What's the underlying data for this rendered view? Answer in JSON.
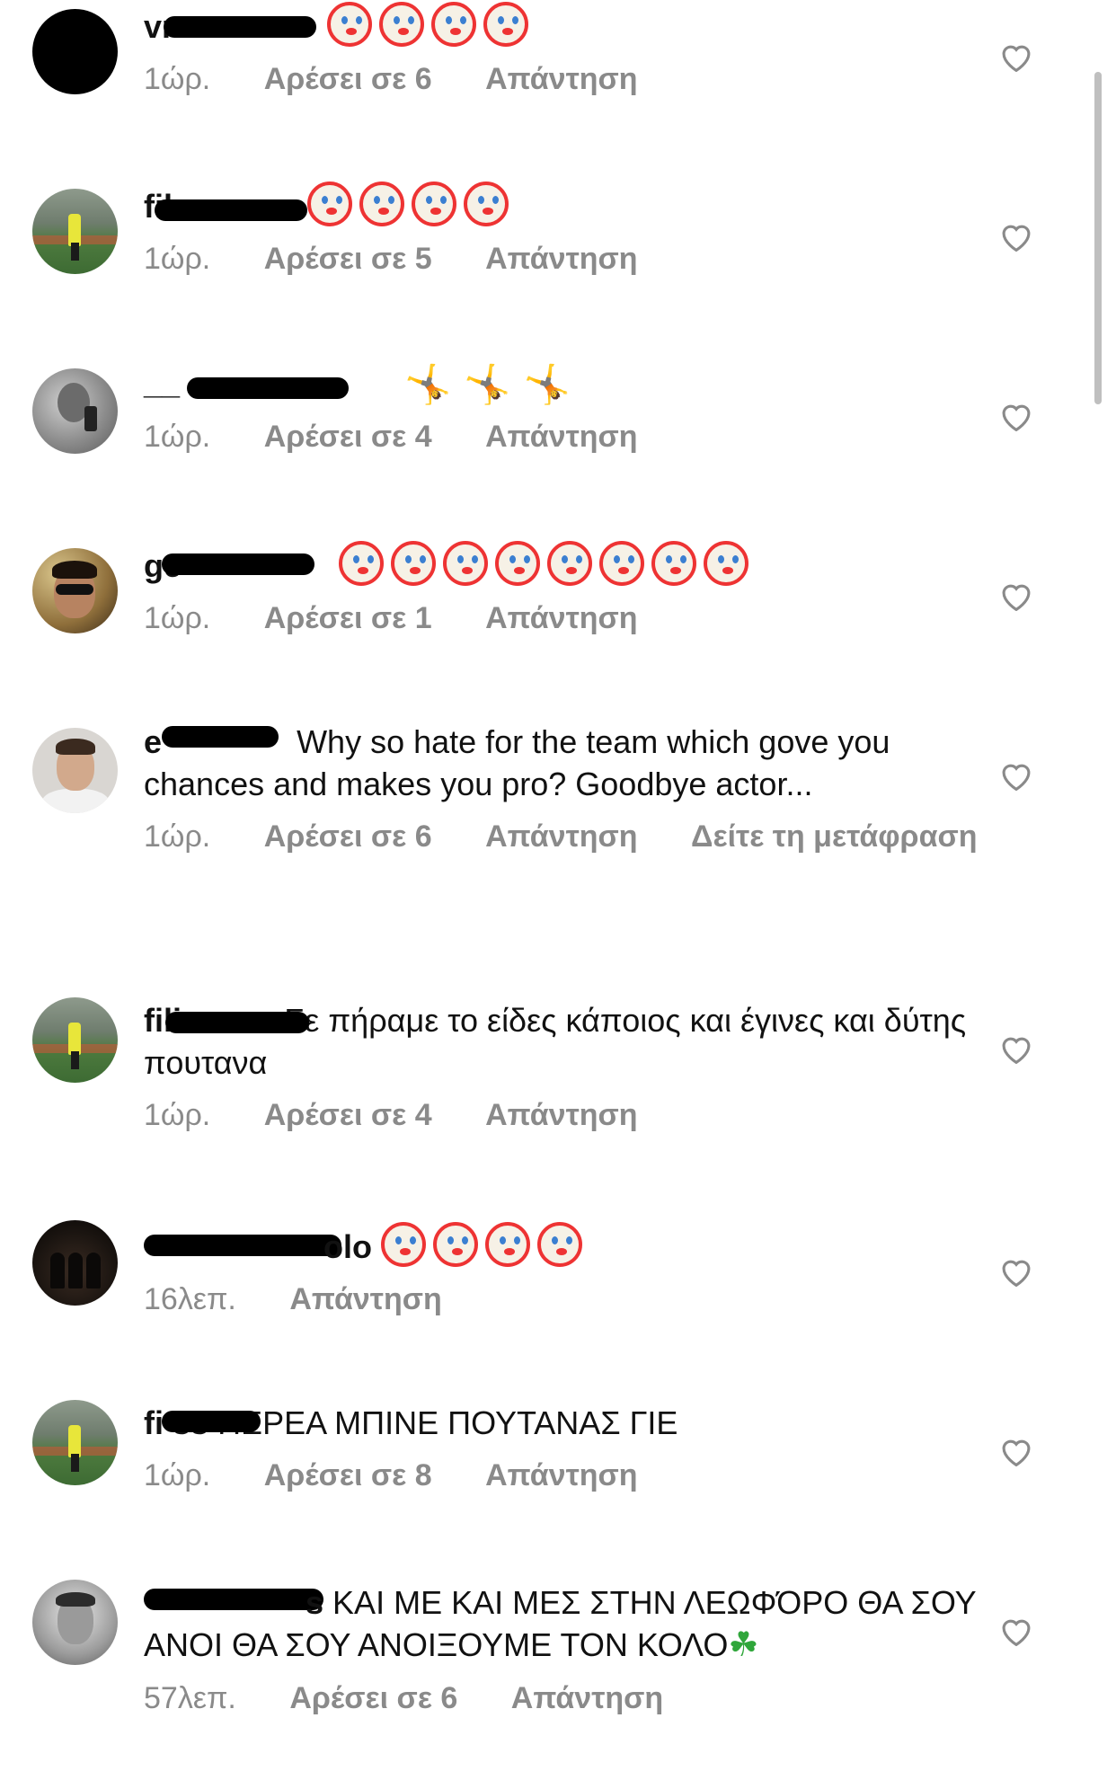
{
  "comments": [
    {
      "username": "vr",
      "text": "",
      "emoji": "clown",
      "emoji_count": 4,
      "time": "1ώρ.",
      "likes": "Αρέσει σε 6",
      "reply": "Απάντηση",
      "translate": ""
    },
    {
      "username": "fil",
      "text": "",
      "emoji": "clown",
      "emoji_count": 4,
      "time": "1ώρ.",
      "likes": "Αρέσει σε 5",
      "reply": "Απάντηση",
      "translate": ""
    },
    {
      "username": "__",
      "text": "",
      "emoji": "person-cartwheeling",
      "emoji_count": 3,
      "time": "1ώρ.",
      "likes": "Αρέσει σε 4",
      "reply": "Απάντηση",
      "translate": ""
    },
    {
      "username": "ge",
      "text": "",
      "emoji": "clown",
      "emoji_count": 8,
      "time": "1ώρ.",
      "likes": "Αρέσει σε 1",
      "reply": "Απάντηση",
      "translate": ""
    },
    {
      "username": "e",
      "text": "Why so hate for the team which gove you chances and makes you pro? Goodbye actor...",
      "emoji": "",
      "emoji_count": 0,
      "time": "1ώρ.",
      "likes": "Αρέσει σε 6",
      "reply": "Απάντηση",
      "translate": "Δείτε τη μετάφραση"
    },
    {
      "username": "fili",
      "text": "Σε πήραμε το είδες κάποιος και έγινες και δύτης πουτανα",
      "emoji": "",
      "emoji_count": 0,
      "time": "1ώρ.",
      "likes": "Αρέσει σε 4",
      "reply": "Απάντηση",
      "translate": ""
    },
    {
      "username": "olo",
      "text": "",
      "emoji": "clown",
      "emoji_count": 4,
      "time": "16λεπ.",
      "likes": "",
      "reply": "Απάντηση",
      "translate": ""
    },
    {
      "username": "fi ss",
      "text": "ΠΕΡΕΑ ΜΠΙΝΕ ΠΟΥΤΑΝΑΣ ΓΙΕ",
      "emoji": "",
      "emoji_count": 0,
      "time": "1ώρ.",
      "likes": "Αρέσει σε 8",
      "reply": "Απάντηση",
      "translate": ""
    },
    {
      "username": "s",
      "text": "ΚΑΙ ΜΕ ΚΑΙ ΜΕΣ ΣΤΗΝ ΛΕΩΦΌΡΟ ΘΑ ΣΟΥ ΑΝΟΙ ΘΑ ΣΟΥ ΑΝΟΙΞΟΥΜΕ ΤΟΝ ΚΟΛΟ",
      "emoji": "shamrock",
      "emoji_count": 1,
      "time": "57λεπ.",
      "likes": "Αρέσει σε 6",
      "reply": "Απάντηση",
      "translate": ""
    }
  ],
  "icons": {
    "like": "heart-outline-icon"
  },
  "colors": {
    "meta_text": "#8a8a8a",
    "text": "#111111",
    "redaction": "#000000"
  }
}
